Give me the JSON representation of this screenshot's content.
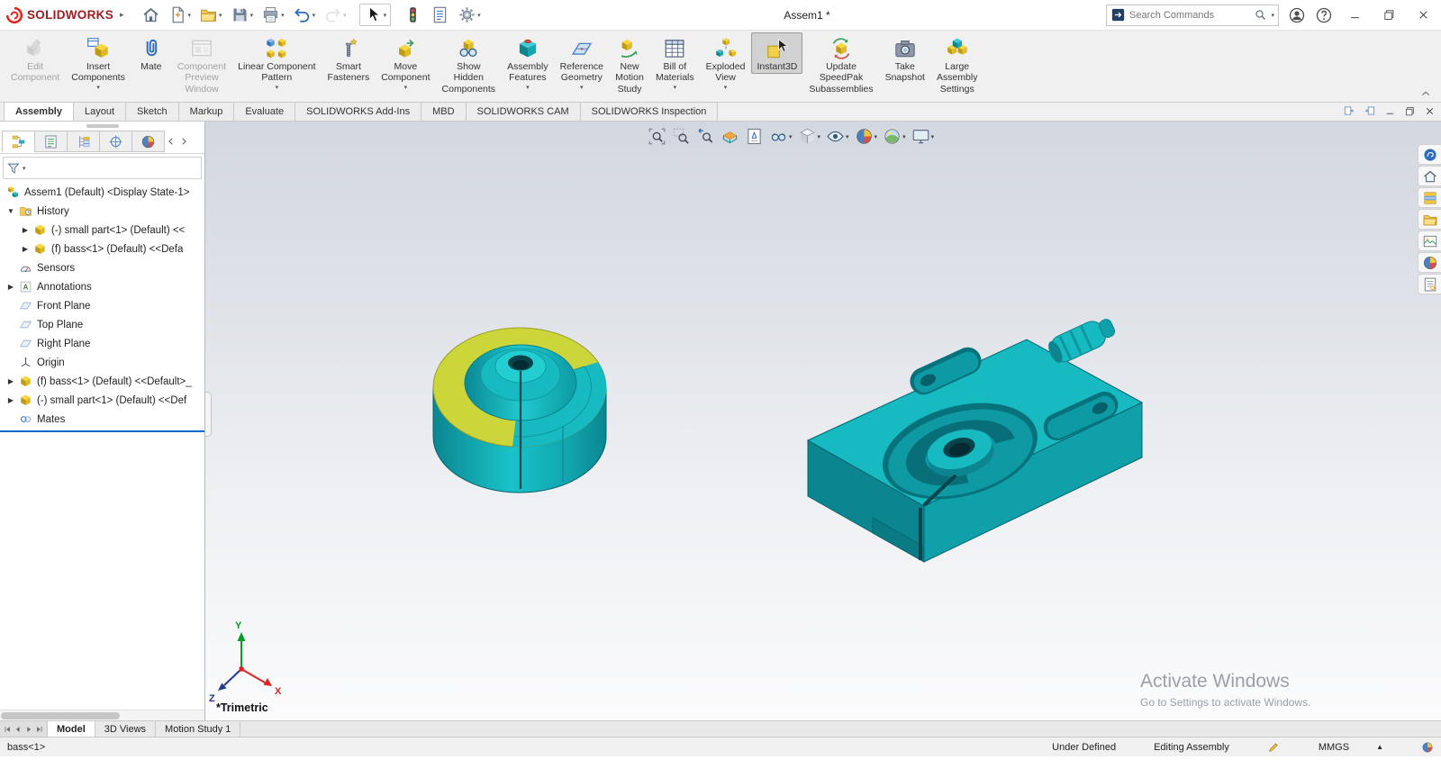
{
  "colors": {
    "model_teal": "#17bac0",
    "model_teal_mid": "#0fa0aa",
    "model_teal_dark": "#0b8691",
    "model_teal_deep": "#07727c",
    "model_yellow": "#ccd53a",
    "brand_red": "#9f1c20",
    "logo_red": "#e2231a",
    "rollback_blue": "#0068c9"
  },
  "icons": {
    "chevron-down": "▾",
    "expander-expanded": "▼",
    "expander-collapsed": "▶",
    "units-arrow": "▲",
    "brand-arrow": "▸"
  },
  "titlebar": {
    "brand": "SOLIDWORKS",
    "document_title": "Assem1 *",
    "search_placeholder": "Search Commands",
    "quick_tools": [
      {
        "name": "home"
      },
      {
        "name": "new-document",
        "dropdown": true
      },
      {
        "name": "open",
        "dropdown": true
      },
      {
        "name": "save",
        "dropdown": true
      },
      {
        "name": "print",
        "dropdown": true
      },
      {
        "name": "undo",
        "dropdown": true
      },
      {
        "name": "redo",
        "dropdown": true,
        "disabled": true
      },
      {
        "name": "select",
        "dropdown": true,
        "boxed": true
      },
      {
        "name": "rebuild"
      },
      {
        "name": "file-properties"
      },
      {
        "name": "options",
        "dropdown": true
      }
    ]
  },
  "ribbon": {
    "buttons": [
      {
        "id": "edit-component",
        "label": [
          "Edit",
          "Component"
        ],
        "disabled": true
      },
      {
        "id": "insert-components",
        "label": [
          "Insert",
          "Components"
        ],
        "dropdown": true
      },
      {
        "id": "mate",
        "label": [
          "Mate"
        ]
      },
      {
        "id": "component-preview-window",
        "label": [
          "Component",
          "Preview",
          "Window"
        ],
        "disabled": true
      },
      {
        "id": "linear-component-pattern",
        "label": [
          "Linear Component",
          "Pattern"
        ],
        "dropdown": true
      },
      {
        "id": "smart-fasteners",
        "label": [
          "Smart",
          "Fasteners"
        ]
      },
      {
        "id": "move-component",
        "label": [
          "Move",
          "Component"
        ],
        "dropdown": true
      },
      {
        "id": "show-hidden-components",
        "label": [
          "Show",
          "Hidden",
          "Components"
        ]
      },
      {
        "id": "assembly-features",
        "label": [
          "Assembly",
          "Features"
        ],
        "dropdown": true
      },
      {
        "id": "reference-geometry",
        "label": [
          "Reference",
          "Geometry"
        ],
        "dropdown": true
      },
      {
        "id": "new-motion-study",
        "label": [
          "New",
          "Motion",
          "Study"
        ]
      },
      {
        "id": "bill-of-materials",
        "label": [
          "Bill of",
          "Materials"
        ],
        "dropdown": true
      },
      {
        "id": "exploded-view",
        "label": [
          "Exploded",
          "View"
        ],
        "dropdown": true
      },
      {
        "id": "instant3d",
        "label": [
          "Instant3D"
        ],
        "active": true
      },
      {
        "id": "update-speedpak-subassemblies",
        "label": [
          "Update",
          "SpeedPak",
          "Subassemblies"
        ]
      },
      {
        "id": "take-snapshot",
        "label": [
          "Take",
          "Snapshot"
        ]
      },
      {
        "id": "large-assembly-settings",
        "label": [
          "Large",
          "Assembly",
          "Settings"
        ]
      }
    ]
  },
  "command_tabs": [
    {
      "label": "Assembly",
      "active": true
    },
    {
      "label": "Layout"
    },
    {
      "label": "Sketch"
    },
    {
      "label": "Markup"
    },
    {
      "label": "Evaluate"
    },
    {
      "label": "SOLIDWORKS Add-Ins"
    },
    {
      "label": "MBD"
    },
    {
      "label": "SOLIDWORKS CAM"
    },
    {
      "label": "SOLIDWORKS Inspection"
    }
  ],
  "panel_tabs": [
    {
      "name": "featuremanager",
      "active": true
    },
    {
      "name": "propertymanager"
    },
    {
      "name": "configurationmanager"
    },
    {
      "name": "dimxpertmanager"
    },
    {
      "name": "displaymanager"
    }
  ],
  "feature_tree": {
    "filter_value": "",
    "items": [
      {
        "label": "Assem1 (Default) <Display State-1>",
        "icon": "assembly",
        "indent": 0,
        "noslot": true
      },
      {
        "label": "History",
        "icon": "history",
        "indent": 0,
        "expander": "down"
      },
      {
        "label": "(-) small part<1> (Default) <<",
        "icon": "part",
        "indent": 1,
        "expander": "right"
      },
      {
        "label": "(f) bass<1> (Default) <<Defa",
        "icon": "part",
        "indent": 1,
        "expander": "right"
      },
      {
        "label": "Sensors",
        "icon": "sensors",
        "indent": 0
      },
      {
        "label": "Annotations",
        "icon": "annotations",
        "indent": 0,
        "expander": "right"
      },
      {
        "label": "Front Plane",
        "icon": "plane",
        "indent": 0
      },
      {
        "label": "Top Plane",
        "icon": "plane",
        "indent": 0
      },
      {
        "label": "Right Plane",
        "icon": "plane",
        "indent": 0
      },
      {
        "label": "Origin",
        "icon": "origin",
        "indent": 0
      },
      {
        "label": "(f) bass<1> (Default) <<Default>_",
        "icon": "part",
        "indent": 0,
        "expander": "right"
      },
      {
        "label": "(-) small part<1> (Default) <<Def",
        "icon": "part",
        "indent": 0,
        "expander": "right"
      },
      {
        "label": "Mates",
        "icon": "mates",
        "indent": 0
      }
    ]
  },
  "viewport": {
    "view_label": "*Trimetric",
    "watermark": {
      "line1": "Activate Windows",
      "line2": "Go to Settings to activate Windows."
    },
    "triad_labels": {
      "x": "X",
      "y": "Y",
      "z": "Z"
    },
    "hud": [
      {
        "name": "zoom-fit"
      },
      {
        "name": "zoom-area"
      },
      {
        "name": "previous-view"
      },
      {
        "name": "section-view"
      },
      {
        "name": "annotation-views"
      },
      {
        "name": "hide-show-items",
        "dropdown": true
      },
      {
        "name": "display-style",
        "dropdown": true
      },
      {
        "name": "view-settings",
        "dropdown": true
      },
      {
        "name": "edit-appearance",
        "dropdown": true
      },
      {
        "name": "apply-scene",
        "dropdown": true
      },
      {
        "name": "view-selector",
        "dropdown": true
      }
    ]
  },
  "task_pane": [
    "threedexperience",
    "resources",
    "design-library",
    "file-explorer",
    "view-palette",
    "appearances",
    "custom-properties"
  ],
  "bottom_tabs": [
    {
      "label": "Model",
      "active": true
    },
    {
      "label": "3D Views"
    },
    {
      "label": "Motion Study 1"
    }
  ],
  "statusbar": {
    "selection": "bass<1>",
    "definition_status": "Under Defined",
    "mode": "Editing Assembly",
    "units": "MMGS"
  }
}
